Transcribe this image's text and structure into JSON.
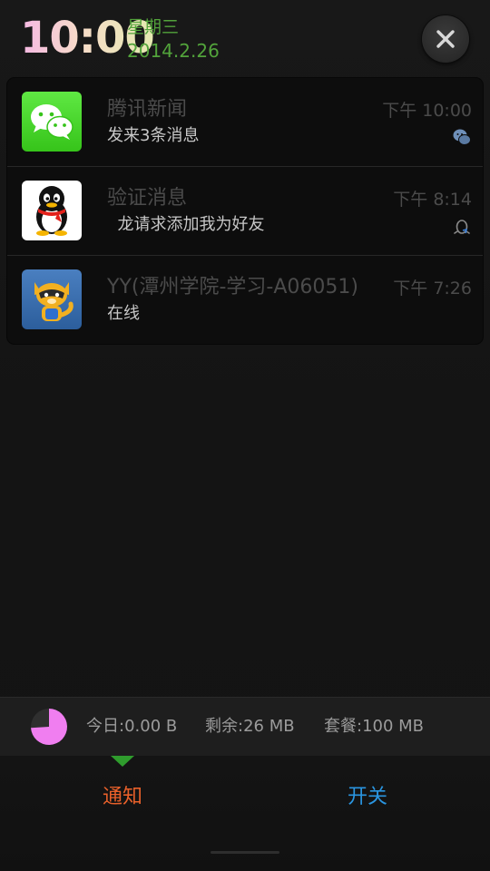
{
  "header": {
    "time": "10:00",
    "weekday": "星期三",
    "date": "2014.2.26",
    "close_icon": "close-icon"
  },
  "notifications": [
    {
      "app_icon": "wechat-icon",
      "title": "腾讯新闻",
      "body": "发来3条消息",
      "time": "下午 10:00",
      "small_icon": "wechat-small-icon"
    },
    {
      "app_icon": "qq-penguin-icon",
      "title": "验证消息",
      "body": "  龙请求添加我为好友",
      "time": "下午 8:14",
      "small_icon": "qq-small-icon"
    },
    {
      "app_icon": "yy-raccoon-icon",
      "title": "YY(潭州学院-学习-A06051)",
      "body": "在线",
      "time": "下午 7:26",
      "small_icon": ""
    }
  ],
  "data_usage": {
    "today": "今日:0.00 B",
    "remaining": "剩余:26 MB",
    "plan": "套餐:100 MB",
    "used_fraction": 0.74,
    "pie_color": "#f07ef0"
  },
  "tabs": {
    "notify": "通知",
    "switch": "开关",
    "active": "notify"
  },
  "colors": {
    "accent_green": "#52a33b",
    "tab_active": "#e8602a",
    "tab_inactive": "#2a95e0"
  }
}
